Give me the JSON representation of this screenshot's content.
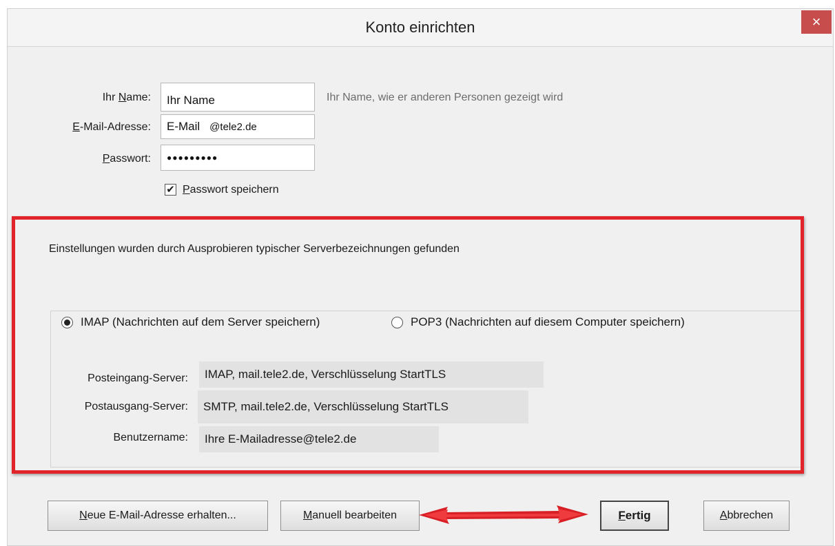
{
  "window": {
    "title": "Konto einrichten",
    "close_label": "×"
  },
  "form": {
    "name_label_pre": "Ihr ",
    "name_label_u": "N",
    "name_label_post": "ame:",
    "name_value": "Ihr Name",
    "name_hint": "Ihr Name, wie er anderen Personen gezeigt wird",
    "email_label_u": "E",
    "email_label_post": "-Mail-Adresse:",
    "email_value_user": "E-Mail",
    "email_value_domain": "@tele2.de",
    "password_label_u": "P",
    "password_label_post": "asswort:",
    "password_value": "●●●●●●●●●",
    "save_password_checked": true,
    "save_password_u": "P",
    "save_password_post": "asswort speichern",
    "checkmark": "✔"
  },
  "settings": {
    "found_text": "Einstellungen wurden durch Ausprobieren typischer Serverbezeichnungen gefunden",
    "imap_label": "IMAP (Nachrichten auf dem Server speichern)",
    "imap_selected": true,
    "pop3_label": "POP3 (Nachrichten auf diesem Computer speichern)",
    "pop3_selected": false,
    "incoming_label": "Posteingang-Server:",
    "incoming_value": "IMAP, mail.tele2.de, Verschlüsselung StartTLS",
    "outgoing_label": "Postausgang-Server:",
    "outgoing_value": "SMTP, mail.tele2.de, Verschlüsselung StartTLS",
    "username_label": "Benutzername:",
    "username_value": "Ihre E-Mailadresse@tele2.de"
  },
  "buttons": {
    "new_email_u": "N",
    "new_email_post": "eue E-Mail-Adresse erhalten...",
    "manual_u": "M",
    "manual_post": "anuell bearbeiten",
    "done_u": "F",
    "done_post": "ertig",
    "cancel_u": "A",
    "cancel_post": "bbrechen"
  },
  "colors": {
    "highlight": "#e0242a",
    "close_button": "#c74c4c"
  },
  "annotations": {
    "arrow": "double-headed red arrow between Manuell bearbeiten and Fertig"
  }
}
